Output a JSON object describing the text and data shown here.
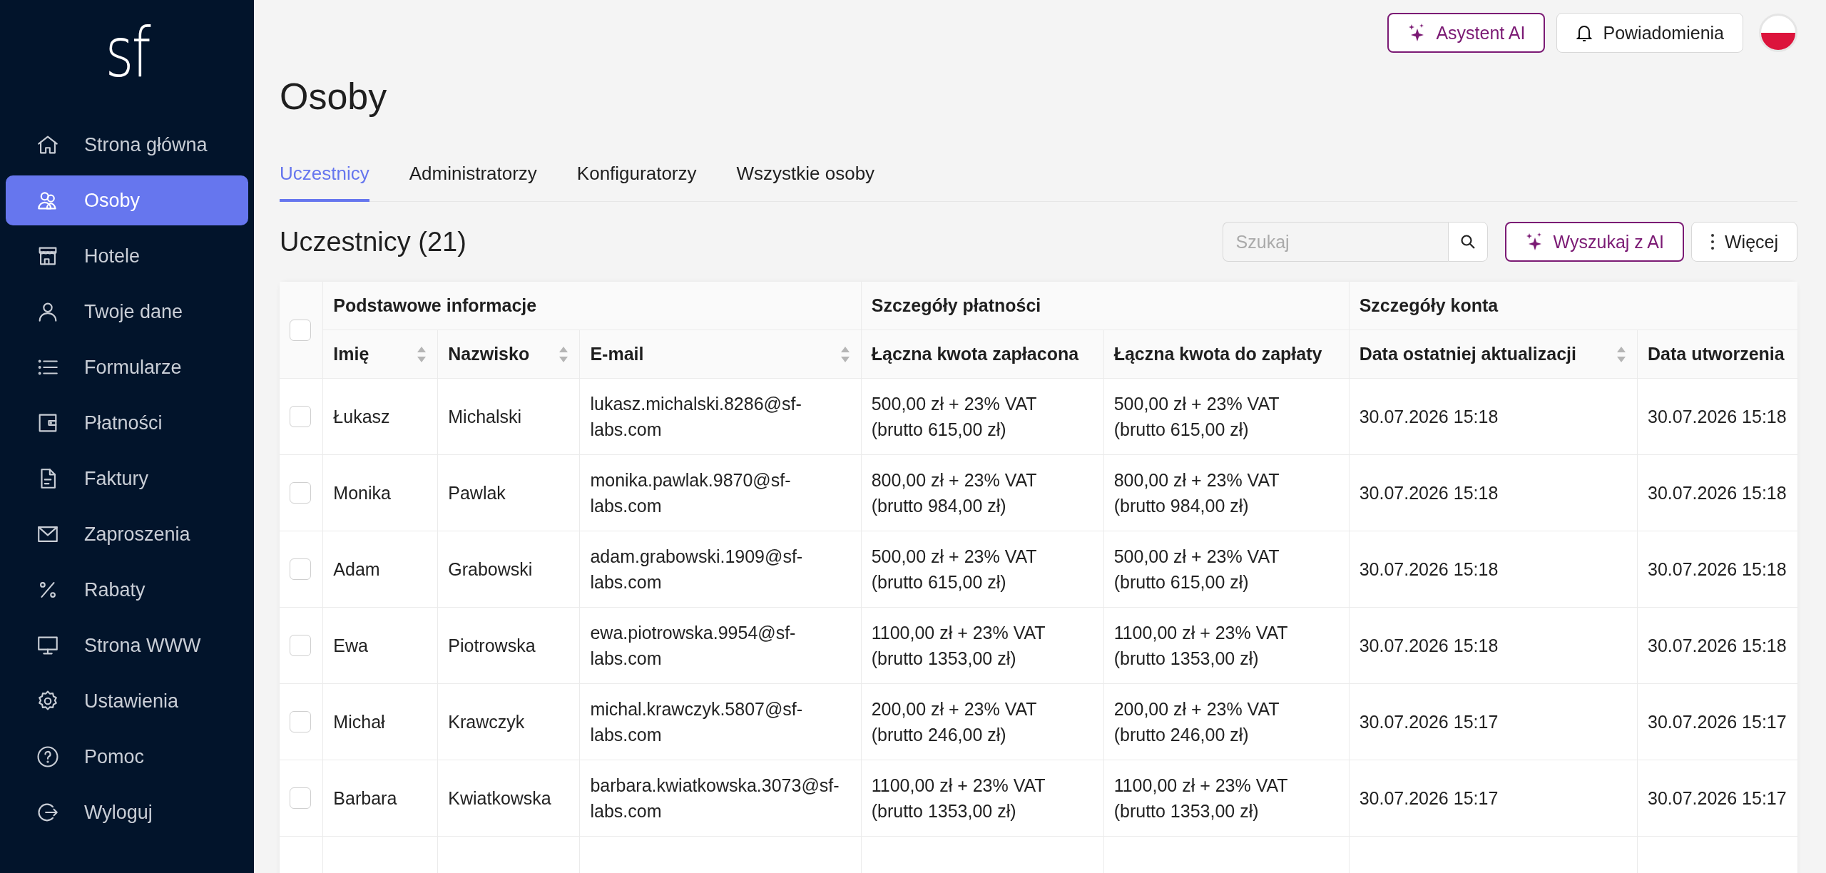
{
  "sidebar": {
    "logo": "sf",
    "items": [
      {
        "label": "Strona główna",
        "selected": false
      },
      {
        "label": "Osoby",
        "selected": true
      },
      {
        "label": "Hotele",
        "selected": false
      },
      {
        "label": "Twoje dane",
        "selected": false
      },
      {
        "label": "Formularze",
        "selected": false
      },
      {
        "label": "Płatności",
        "selected": false
      },
      {
        "label": "Faktury",
        "selected": false
      },
      {
        "label": "Zaproszenia",
        "selected": false
      },
      {
        "label": "Rabaty",
        "selected": false
      },
      {
        "label": "Strona WWW",
        "selected": false
      },
      {
        "label": "Ustawienia",
        "selected": false
      },
      {
        "label": "Pomoc",
        "selected": false
      },
      {
        "label": "Wyloguj",
        "selected": false
      }
    ]
  },
  "header_actions": [
    {
      "label": "Asystent AI",
      "kind": "ai"
    },
    {
      "label": "Powiadomienia",
      "kind": "bell"
    }
  ],
  "page_title": "Osoby",
  "tabs": [
    {
      "label": "Uczestnicy",
      "selected": true
    },
    {
      "label": "Administratorzy",
      "selected": false
    },
    {
      "label": "Konfiguratorzy",
      "selected": false
    },
    {
      "label": "Wszystkie osoby",
      "selected": false
    }
  ],
  "section_title": "Uczestnicy (21)",
  "search": {
    "placeholder": "Szukaj"
  },
  "toolbar_buttons": [
    {
      "label": "Wyszukaj z AI",
      "kind": "ai"
    },
    {
      "label": "Więcej",
      "kind": "more"
    }
  ],
  "table": {
    "select_all_checked": false,
    "groups": [
      {
        "label": "Podstawowe informacje",
        "columns": [
          {
            "label": "Imię",
            "sortable": true
          },
          {
            "label": "Nazwisko",
            "sortable": true
          },
          {
            "label": "E-mail",
            "sortable": true
          }
        ]
      },
      {
        "label": "Szczegóły płatności",
        "columns": [
          {
            "label": "Łączna kwota zapłacona",
            "sortable": false
          },
          {
            "label": "Łączna kwota do zapłaty",
            "sortable": false
          }
        ]
      },
      {
        "label": "Szczegóły konta",
        "columns": [
          {
            "label": "Data ostatniej aktualizacji",
            "sortable": true
          },
          {
            "label": "Data utworzenia",
            "sortable": false
          }
        ]
      }
    ],
    "rows": [
      {
        "checked": false,
        "first_name": "Łukasz",
        "last_name": "Michalski",
        "email": "lukasz.michalski.8286@sf-labs.com",
        "paid": [
          "500,00 zł + 23% VAT",
          "(brutto 615,00 zł)"
        ],
        "due": [
          "500,00 zł + 23% VAT",
          "(brutto 615,00 zł)"
        ],
        "updated": "30.07.2026 15:18",
        "created": "30.07.2026 15:18"
      },
      {
        "checked": false,
        "first_name": "Monika",
        "last_name": "Pawlak",
        "email": "monika.pawlak.9870@sf-labs.com",
        "paid": [
          "800,00 zł + 23% VAT",
          "(brutto 984,00 zł)"
        ],
        "due": [
          "800,00 zł + 23% VAT",
          "(brutto 984,00 zł)"
        ],
        "updated": "30.07.2026 15:18",
        "created": "30.07.2026 15:18"
      },
      {
        "checked": false,
        "first_name": "Adam",
        "last_name": "Grabowski",
        "email": "adam.grabowski.1909@sf-labs.com",
        "paid": [
          "500,00 zł + 23% VAT",
          "(brutto 615,00 zł)"
        ],
        "due": [
          "500,00 zł + 23% VAT",
          "(brutto 615,00 zł)"
        ],
        "updated": "30.07.2026 15:18",
        "created": "30.07.2026 15:18"
      },
      {
        "checked": false,
        "first_name": "Ewa",
        "last_name": "Piotrowska",
        "email": "ewa.piotrowska.9954@sf-labs.com",
        "paid": [
          "1100,00 zł + 23% VAT",
          "(brutto 1353,00 zł)"
        ],
        "due": [
          "1100,00 zł + 23% VAT",
          "(brutto 1353,00 zł)"
        ],
        "updated": "30.07.2026 15:18",
        "created": "30.07.2026 15:18"
      },
      {
        "checked": false,
        "first_name": "Michał",
        "last_name": "Krawczyk",
        "email": "michal.krawczyk.5807@sf-labs.com",
        "paid": [
          "200,00 zł + 23% VAT",
          "(brutto 246,00 zł)"
        ],
        "due": [
          "200,00 zł + 23% VAT",
          "(brutto 246,00 zł)"
        ],
        "updated": "30.07.2026 15:17",
        "created": "30.07.2026 15:17"
      },
      {
        "checked": false,
        "first_name": "Barbara",
        "last_name": "Kwiatkowska",
        "email": "barbara.kwiatkowska.3073@sf-labs.com",
        "paid": [
          "1100,00 zł + 23% VAT",
          "(brutto 1353,00 zł)"
        ],
        "due": [
          "1100,00 zł + 23% VAT",
          "(brutto 1353,00 zł)"
        ],
        "updated": "30.07.2026 15:17",
        "created": "30.07.2026 15:17"
      }
    ]
  }
}
